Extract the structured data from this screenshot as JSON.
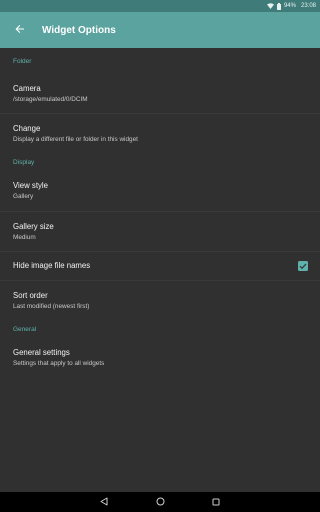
{
  "status_bar": {
    "battery": "94%",
    "time": "23:08"
  },
  "app_bar": {
    "title": "Widget Options"
  },
  "sections": {
    "folder": {
      "header": "Folder",
      "camera": {
        "title": "Camera",
        "summary": "/storage/emulated/0/DCIM"
      },
      "change": {
        "title": "Change",
        "summary": "Display a different file or folder in this widget"
      }
    },
    "display": {
      "header": "Display",
      "view_style": {
        "title": "View style",
        "summary": "Gallery"
      },
      "gallery_size": {
        "title": "Gallery size",
        "summary": "Medium"
      },
      "hide_names": {
        "title": "Hide image file names",
        "checked": true
      },
      "sort_order": {
        "title": "Sort order",
        "summary": "Last modified (newest first)"
      }
    },
    "general": {
      "header": "General",
      "general_settings": {
        "title": "General settings",
        "summary": "Settings that apply to all widgets"
      }
    }
  },
  "colors": {
    "accent": "#5fb1ab",
    "app_bar": "#5aa39f",
    "status_bar": "#3f7b78",
    "background": "#303030"
  }
}
